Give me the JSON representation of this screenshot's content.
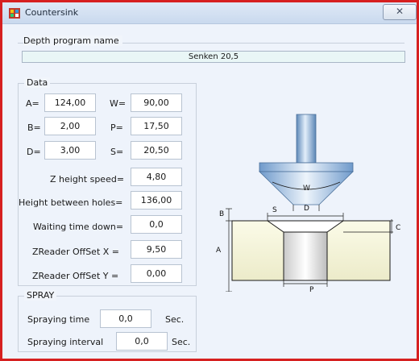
{
  "window": {
    "title": "Countersink",
    "close_glyph": "✕"
  },
  "depth_program": {
    "label": "Depth program name",
    "value": "Senken 20,5"
  },
  "data_group": {
    "title": "Data",
    "a_label": "A=",
    "a_value": "124,00",
    "w_label": "W=",
    "w_value": "90,00",
    "b_label": "B=",
    "b_value": "2,00",
    "p_label": "P=",
    "p_value": "17,50",
    "d_label": "D=",
    "d_value": "3,00",
    "s_label": "S=",
    "s_value": "20,50",
    "z_speed_label": "Z height speed=",
    "z_speed_value": "4,80",
    "height_holes_label": "Height between holes=",
    "height_holes_value": "136,00",
    "wait_label": "Waiting time down=",
    "wait_value": "0,0",
    "zr_x_label": "ZReader OffSet X =",
    "zr_x_value": "9,50",
    "zr_y_label": "ZReader OffSet Y =",
    "zr_y_value": "0,00"
  },
  "spray_group": {
    "title": "SPRAY",
    "time_label": "Spraying time",
    "time_value": "0,0",
    "time_unit": "Sec.",
    "interval_label": "Spraying interval",
    "interval_value": "0,0",
    "interval_unit": "Sec."
  },
  "diagram": {
    "w": "W",
    "d": "D",
    "b": "B",
    "s": "S",
    "c": "C",
    "a": "A",
    "p": "P"
  },
  "colors": {
    "border_accent": "#d62020",
    "tool_blue": "#7aa6d6"
  }
}
